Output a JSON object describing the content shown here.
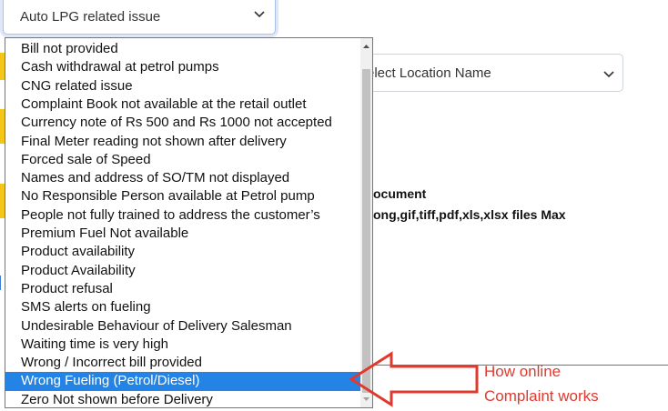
{
  "complaint_type_select": {
    "value": "Auto LPG related issue"
  },
  "location_select": {
    "value": "elect Location Name"
  },
  "document_section": {
    "label_partial": "ocument",
    "hint_partial": "ong,gif,tiff,pdf,xls,xlsx files Max"
  },
  "dropdown": {
    "options": [
      "Bill not provided",
      "Cash withdrawal at petrol pumps",
      "CNG related issue",
      "Complaint Book not available at the retail outlet",
      "Currency note of Rs 500 and Rs 1000 not accepted",
      "Final Meter reading not shown after delivery",
      "Forced sale of Speed",
      "Names and address of SO/TM not displayed",
      "No Responsible Person available at Petrol pump",
      "People not fully trained to address the customer’s",
      "Premium Fuel Not available",
      "Product availability",
      "Product Availability",
      "Product refusal",
      "SMS alerts on fueling",
      "Undesirable Behaviour of Delivery Salesman",
      "Waiting time is very high",
      "Wrong / Incorrect bill provided",
      "Wrong Fueling (Petrol/Diesel)",
      "Zero Not shown before Delivery"
    ],
    "selected_index": 18
  },
  "annotation": {
    "line1": "How online",
    "line2": "Complaint works",
    "color": "#e03a2f"
  },
  "colors": {
    "selection": "#2484e6",
    "accent_yellow": "#f5c518",
    "rule_blue": "#3b7dd8"
  }
}
